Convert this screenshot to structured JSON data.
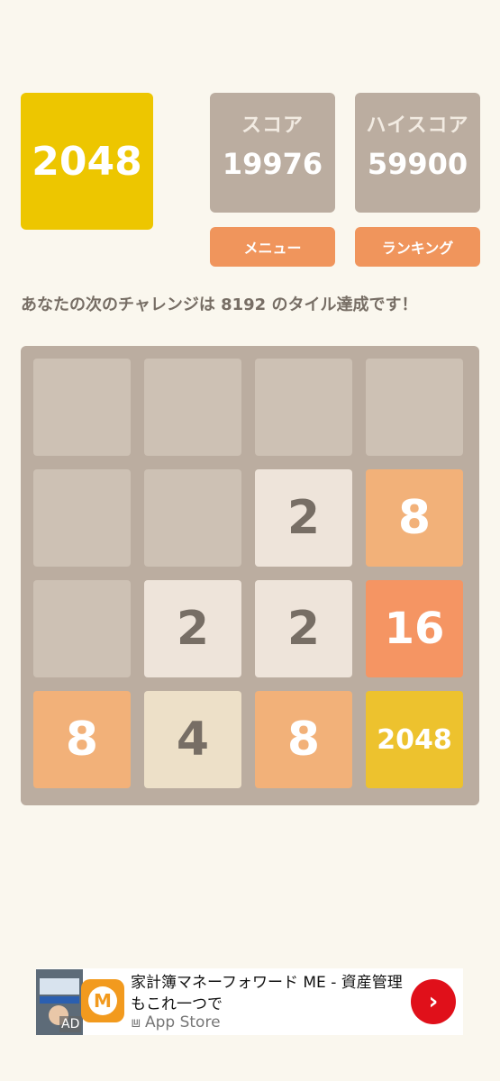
{
  "logo": "2048",
  "score": {
    "label": "スコア",
    "value": "19976"
  },
  "highscore": {
    "label": "ハイスコア",
    "value": "59900"
  },
  "buttons": {
    "menu": "メニュー",
    "ranking": "ランキング"
  },
  "message": "あなたの次のチャレンジは 8192 のタイル達成です！",
  "board": [
    [
      "",
      "",
      "",
      ""
    ],
    [
      "",
      "",
      "2",
      "8"
    ],
    [
      "",
      "2",
      "2",
      "16"
    ],
    [
      "8",
      "4",
      "8",
      "2048"
    ]
  ],
  "tile_colors": {
    "empty": "#cdc1b4",
    "2": "#eee4da",
    "4": "#ede0c8",
    "8": "#f2b179",
    "16": "#f59563",
    "2048": "#edc22e"
  },
  "ad": {
    "badge": "AD",
    "title": "家計簿マネーフォワード ME - 資産管理もこれ一つで",
    "store": "App Store",
    "store_icon": "app-store-icon",
    "cta_icon": "chevron-right-icon"
  }
}
